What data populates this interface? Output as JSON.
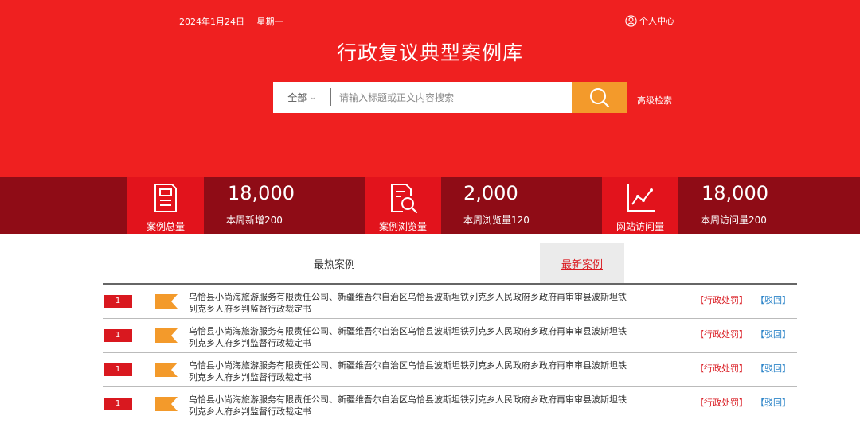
{
  "header": {
    "date": "2024年1月24日",
    "weekday": "星期一",
    "user_center": "个人中心",
    "title": "行政复议典型案例库"
  },
  "search": {
    "scope": "全部",
    "placeholder": "请输入标题或正文内容搜索",
    "advanced": "高级检索"
  },
  "stats": [
    {
      "label": "案例总量",
      "value": "18,000",
      "sub": "本周新增200"
    },
    {
      "label": "案例浏览量",
      "value": "2,000",
      "sub": "本周浏览量120"
    },
    {
      "label": "网站访问量",
      "value": "18,000",
      "sub": "本周访问量200"
    }
  ],
  "tabs": {
    "hot": "最热案例",
    "new": "最新案例"
  },
  "cases": [
    {
      "rank": "1",
      "title": "乌恰县小尚海旅游服务有限责任公司、新疆维吾尔自治区乌恰县波斯坦铁列克乡人民政府乡政府再审审县波斯坦铁列克乡人府乡判监督行政裁定书",
      "tag1": "【行政处罚】",
      "tag2": "【驳回】"
    },
    {
      "rank": "1",
      "title": "乌恰县小尚海旅游服务有限责任公司、新疆维吾尔自治区乌恰县波斯坦铁列克乡人民政府乡政府再审审县波斯坦铁列克乡人府乡判监督行政裁定书",
      "tag1": "【行政处罚】",
      "tag2": "【驳回】"
    },
    {
      "rank": "1",
      "title": "乌恰县小尚海旅游服务有限责任公司、新疆维吾尔自治区乌恰县波斯坦铁列克乡人民政府乡政府再审审县波斯坦铁列克乡人府乡判监督行政裁定书",
      "tag1": "【行政处罚】",
      "tag2": "【驳回】"
    },
    {
      "rank": "1",
      "title": "乌恰县小尚海旅游服务有限责任公司、新疆维吾尔自治区乌恰县波斯坦铁列克乡人民政府乡政府再审审县波斯坦铁列克乡人府乡判监督行政裁定书",
      "tag1": "【行政处罚】",
      "tag2": "【驳回】"
    }
  ],
  "icons": {
    "user": "user-circle-icon",
    "search": "search-icon",
    "stat1": "document-list-icon",
    "stat2": "document-search-icon",
    "stat3": "line-chart-icon",
    "flag": "ribbon-flag-icon"
  },
  "colors": {
    "brand_red": "#ef2020",
    "dark_red": "#8f0c16",
    "accent_orange": "#f39a2b",
    "link_blue": "#2f86c9"
  }
}
